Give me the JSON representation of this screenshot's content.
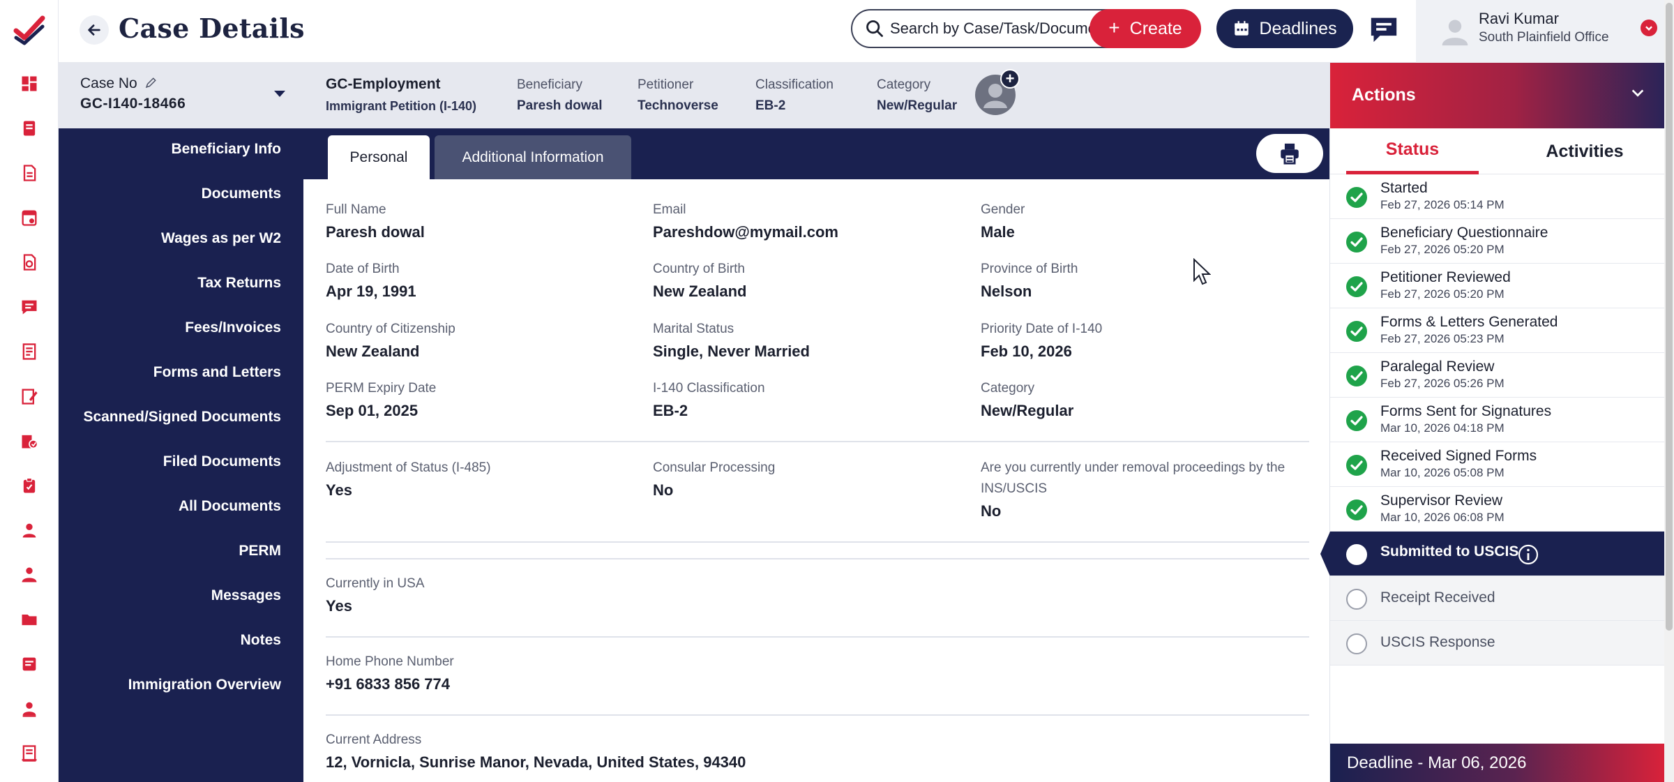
{
  "header": {
    "title": "Case Details",
    "search_placeholder": "Search by Case/Task/Document",
    "create_label": "Create",
    "deadlines_label": "Deadlines"
  },
  "user": {
    "name": "Ravi Kumar",
    "office": "South Plainfield Office"
  },
  "case": {
    "no_label": "Case No",
    "no_value": "GC-I140-18466",
    "type": "GC-Employment",
    "subtype": "Immigrant Petition (I-140)",
    "fields": [
      {
        "label": "Beneficiary",
        "value": "Paresh dowal"
      },
      {
        "label": "Petitioner",
        "value": "Technoverse"
      },
      {
        "label": "Classification",
        "value": "EB-2"
      },
      {
        "label": "Category",
        "value": "New/Regular"
      }
    ]
  },
  "leftnav": {
    "items": [
      "Beneficiary Info",
      "Documents",
      "Wages as per W2",
      "Tax Returns",
      "Fees/Invoices",
      "Forms and Letters",
      "Scanned/Signed Documents",
      "Filed Documents",
      "All Documents",
      "PERM",
      "Messages",
      "Notes",
      "Immigration Overview"
    ]
  },
  "tabs": {
    "personal": "Personal",
    "additional": "Additional Information"
  },
  "personal": {
    "rows": [
      [
        {
          "label": "Full Name",
          "value": "Paresh dowal"
        },
        {
          "label": "Email",
          "value": "Pareshdow@mymail.com"
        },
        {
          "label": "Gender",
          "value": "Male"
        }
      ],
      [
        {
          "label": "Date of Birth",
          "value": "Apr 19, 1991"
        },
        {
          "label": "Country of Birth",
          "value": "New Zealand"
        },
        {
          "label": "Province of Birth",
          "value": "Nelson"
        }
      ],
      [
        {
          "label": "Country of Citizenship",
          "value": "New Zealand"
        },
        {
          "label": "Marital Status",
          "value": "Single, Never Married"
        },
        {
          "label": "Priority Date of I-140",
          "value": "Feb 10, 2026"
        }
      ],
      [
        {
          "label": "PERM Expiry Date",
          "value": "Sep 01, 2025"
        },
        {
          "label": "I-140 Classification",
          "value": "EB-2"
        },
        {
          "label": "Category",
          "value": "New/Regular"
        }
      ]
    ],
    "processing": [
      {
        "label": "Adjustment of Status (I-485)",
        "value": "Yes"
      },
      {
        "label": "Consular Processing",
        "value": "No"
      },
      {
        "label": "Are you currently under removal proceedings by the INS/USCIS",
        "value": "No"
      }
    ],
    "in_usa": {
      "label": "Currently in USA",
      "value": "Yes"
    },
    "home_phone": {
      "label": "Home Phone Number",
      "value": "+91  6833 856 774"
    },
    "address": {
      "label": "Current Address",
      "value": "12, Vornicla, Sunrise Manor, Nevada, United States, 94340"
    }
  },
  "actions": {
    "title": "Actions",
    "tab_status": "Status",
    "tab_activities": "Activities",
    "steps": [
      {
        "name": "Started",
        "date": "Feb 27, 2026 05:14 PM",
        "state": "done"
      },
      {
        "name": "Beneficiary Questionnaire",
        "date": "Feb 27, 2026 05:20 PM",
        "state": "done"
      },
      {
        "name": "Petitioner Reviewed",
        "date": "Feb 27, 2026 05:20 PM",
        "state": "done"
      },
      {
        "name": "Forms & Letters Generated",
        "date": "Feb 27, 2026 05:23 PM",
        "state": "done"
      },
      {
        "name": "Paralegal Review",
        "date": "Feb 27, 2026 05:26 PM",
        "state": "done"
      },
      {
        "name": "Forms Sent for Signatures",
        "date": "Mar 10, 2026 04:18 PM",
        "state": "done"
      },
      {
        "name": "Received Signed Forms",
        "date": "Mar 10, 2026 05:08 PM",
        "state": "done"
      },
      {
        "name": "Supervisor Review",
        "date": "Mar 10, 2026 06:08 PM",
        "state": "done"
      },
      {
        "name": "Submitted to USCIS",
        "date": "",
        "state": "current"
      },
      {
        "name": "Receipt Received",
        "date": "",
        "state": "pending"
      },
      {
        "name": "USCIS Response",
        "date": "",
        "state": "pending"
      }
    ],
    "deadline": "Deadline - Mar 06, 2026"
  },
  "colors": {
    "brand_red": "#d9223a",
    "navy": "#1a2150",
    "success_green": "#1fa34a"
  },
  "icons": {
    "rail": [
      "dashboard-icon",
      "cases-icon",
      "documents-icon",
      "calendar-doc-icon",
      "forms-icon",
      "chat-icon",
      "ledger-icon",
      "edit-doc-icon",
      "reports-icon",
      "clipboard-icon",
      "user-icon",
      "team-icon",
      "folder-icon",
      "notes-icon",
      "contact-icon",
      "book-icon"
    ]
  }
}
